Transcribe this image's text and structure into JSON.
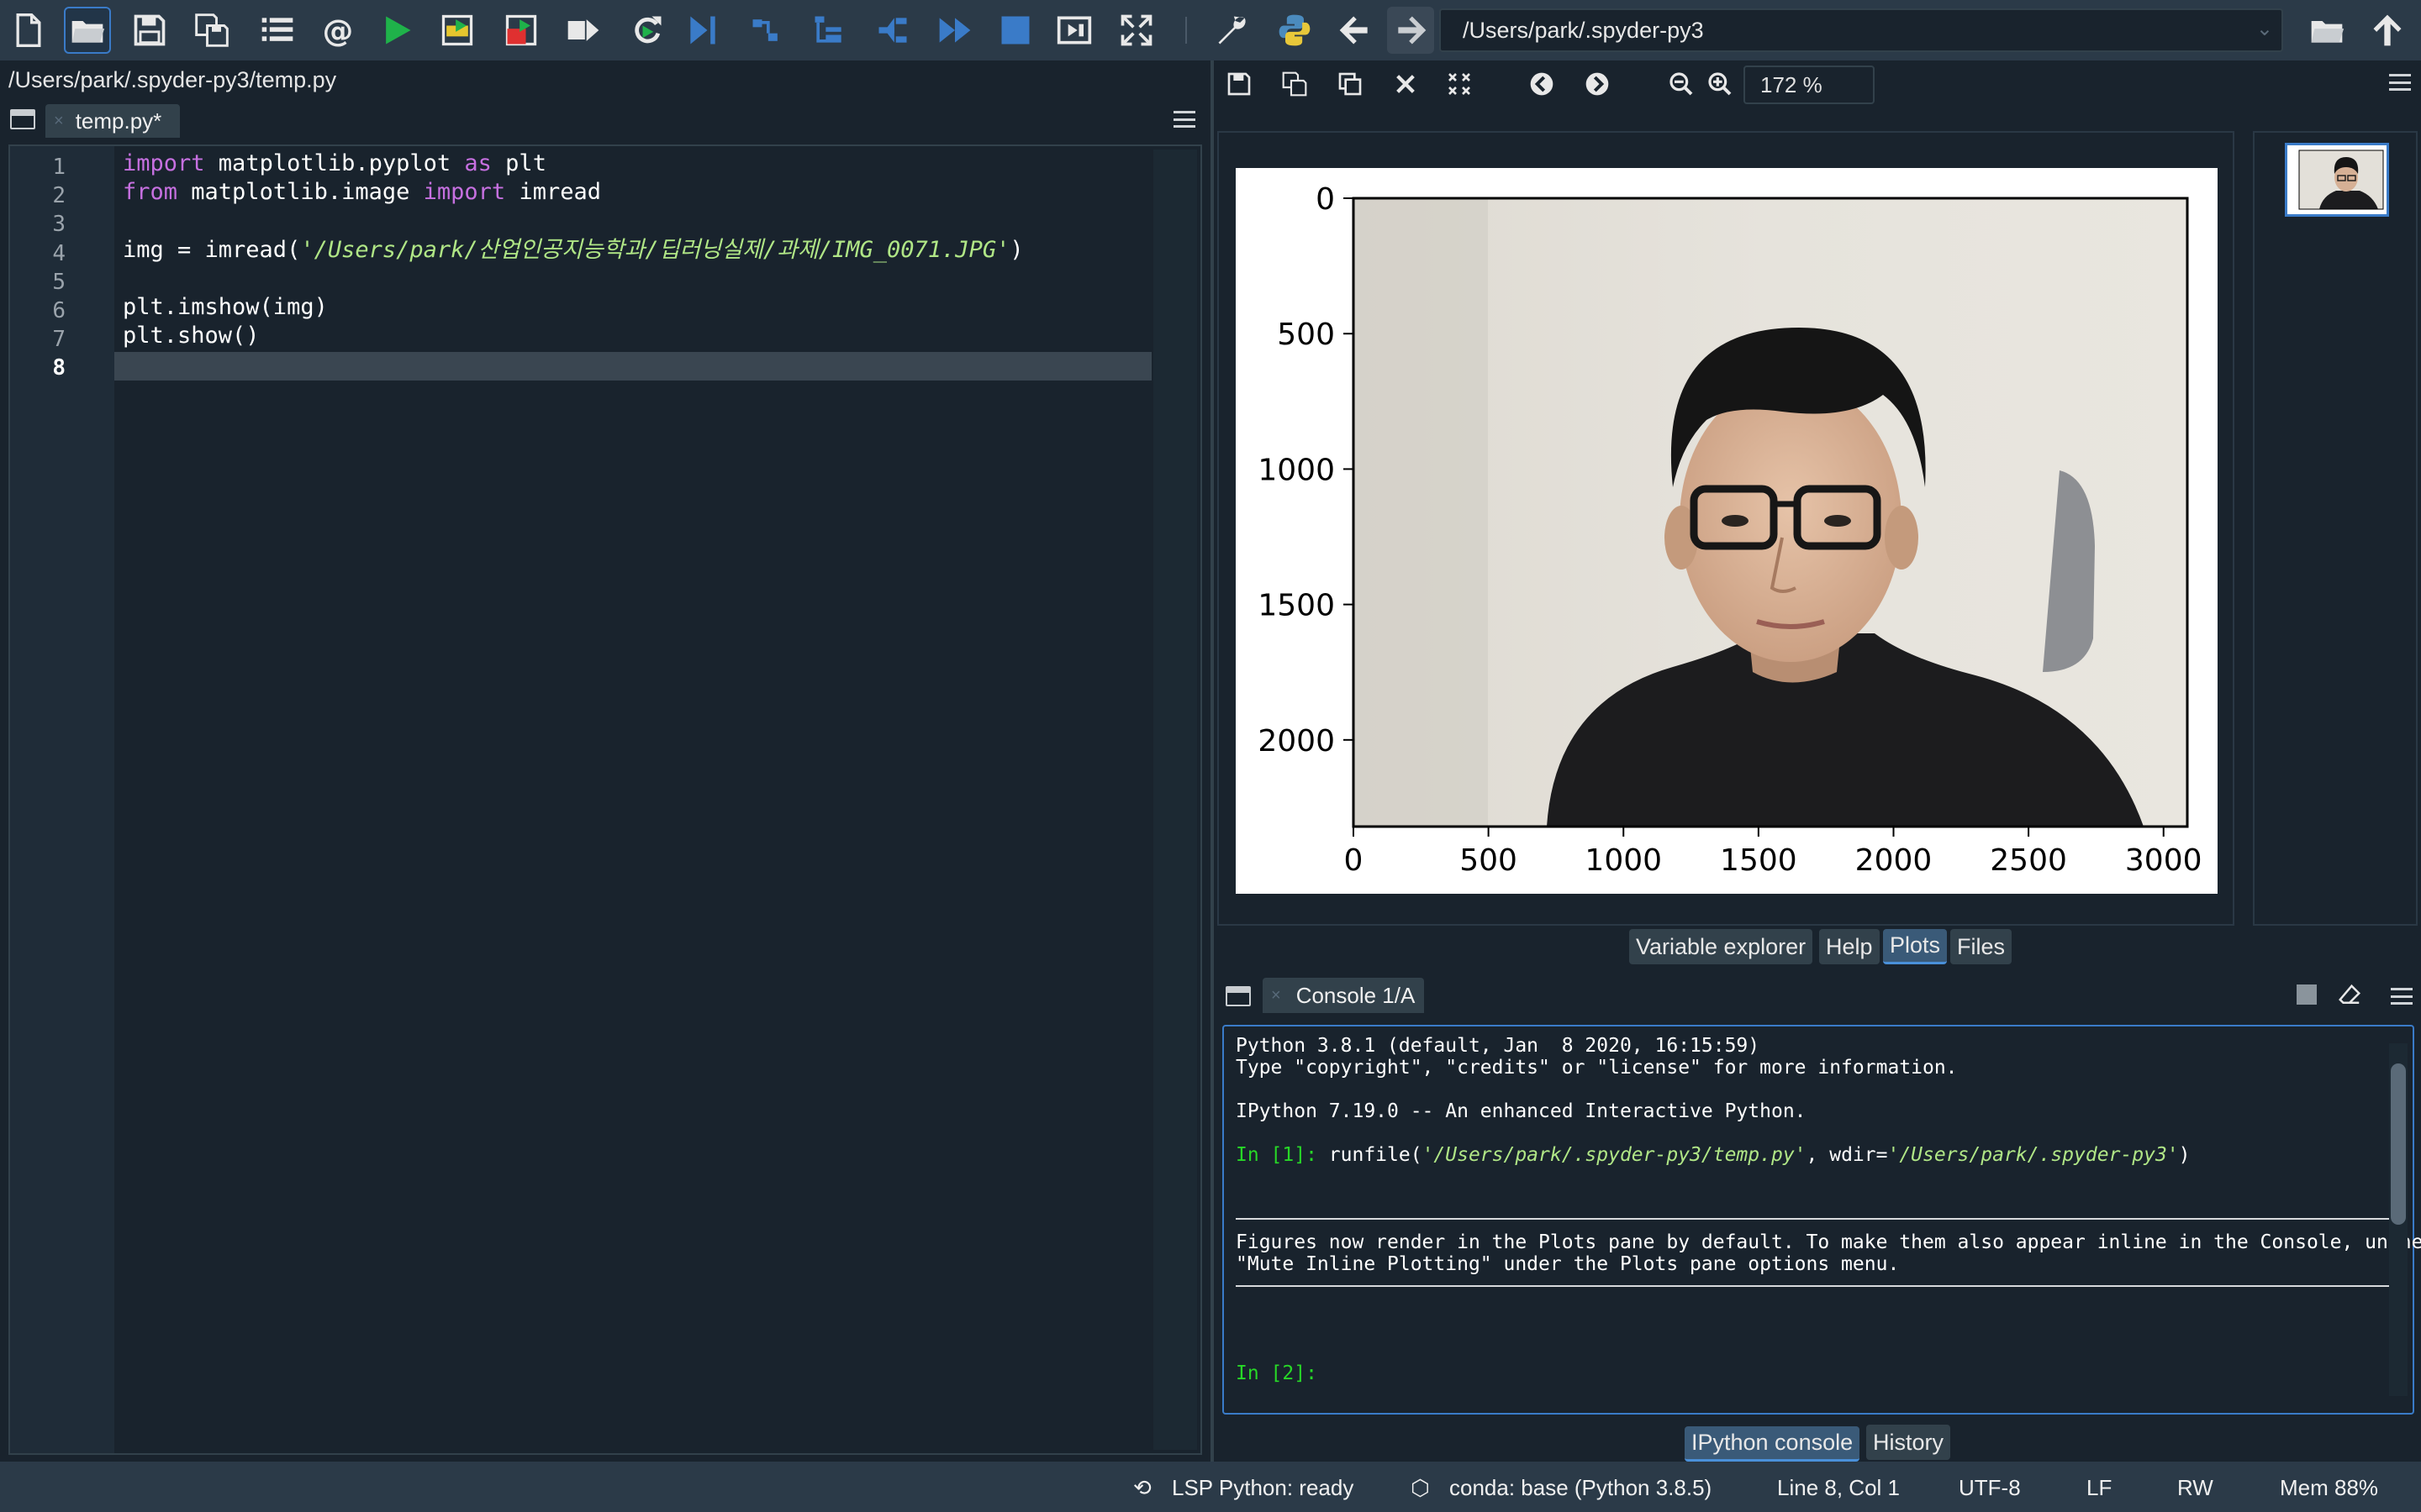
{
  "toolbar": {
    "icons": [
      "new-file-icon",
      "open-file-icon",
      "save-icon",
      "save-all-icon",
      "outline-icon",
      "at-icon",
      "run-icon",
      "run-cell-icon",
      "run-cell-advance-icon",
      "run-selection-icon",
      "debug-icon",
      "step-icon",
      "step-into-icon",
      "step-return-icon",
      "continue-icon",
      "stop-debug-icon",
      "maximize-pane-icon",
      "fullscreen-icon",
      "preferences-icon",
      "python-path-icon",
      "back-icon",
      "forward-icon",
      "browse-folder-icon",
      "parent-dir-icon"
    ],
    "working_dir": "/Users/park/.spyder-py3"
  },
  "editor": {
    "file_path": "/Users/park/.spyder-py3/temp.py",
    "tab_label": "temp.py*",
    "tab_close": "×",
    "current_line": 8,
    "line_numbers": [
      "1",
      "2",
      "3",
      "4",
      "5",
      "6",
      "7",
      "8"
    ],
    "lines": [
      [
        {
          "t": "import",
          "c": "kw"
        },
        {
          "t": " matplotlib.pyplot ",
          "c": ""
        },
        {
          "t": "as",
          "c": "kw"
        },
        {
          "t": " plt",
          "c": ""
        }
      ],
      [
        {
          "t": "from",
          "c": "kw"
        },
        {
          "t": " matplotlib.image ",
          "c": ""
        },
        {
          "t": "import",
          "c": "kw"
        },
        {
          "t": " imread",
          "c": ""
        }
      ],
      [],
      [
        {
          "t": "img = imread(",
          "c": ""
        },
        {
          "t": "'/Users/park/산업인공지능학과/딥러닝실제/과제/IMG_0071.JPG'",
          "c": "str"
        },
        {
          "t": ")",
          "c": ""
        }
      ],
      [],
      [
        {
          "t": "plt.imshow(img)",
          "c": ""
        }
      ],
      [
        {
          "t": "plt.show()",
          "c": ""
        }
      ],
      []
    ]
  },
  "plots": {
    "zoom": "172 %",
    "x_ticks": [
      "0",
      "500",
      "1000",
      "1500",
      "2000",
      "2500",
      "3000"
    ],
    "y_ticks": [
      "0",
      "500",
      "1000",
      "1500",
      "2000"
    ]
  },
  "chart_data": {
    "type": "image",
    "x_ticks": [
      0,
      500,
      1000,
      1500,
      2000,
      2500,
      3000
    ],
    "y_ticks": [
      0,
      500,
      1000,
      1500,
      2000
    ],
    "xlim": [
      0,
      3088
    ],
    "ylim": [
      2320,
      0
    ]
  },
  "plots_tabs": [
    "Variable explorer",
    "Help",
    "Plots",
    "Files"
  ],
  "plots_tab_selected": "Plots",
  "console": {
    "tab_label": "Console 1/A",
    "tab_close": "×",
    "line1": "Python 3.8.1 (default, Jan  8 2020, 16:15:59)",
    "line2": "Type \"copyright\", \"credits\" or \"license\" for more information.",
    "line3": "IPython 7.19.0 -- An enhanced Interactive Python.",
    "in1_prompt": "In [1]:",
    "in1_pre": " runfile(",
    "in1_file": "'/Users/park/.spyder-py3/temp.py'",
    "in1_mid": ", wdir=",
    "in1_wdir": "'/Users/park/.spyder-py3'",
    "in1_post": ")",
    "msg1": "Figures now render in the Plots pane by default. To make them also appear inline in the Console, unchecl",
    "msg2": "\"Mute Inline Plotting\" under the Plots pane options menu.",
    "in2_prompt": "In [2]:"
  },
  "console_tabs": [
    "IPython console",
    "History"
  ],
  "console_tab_selected": "IPython console",
  "statusbar": {
    "lsp": "LSP Python: ready",
    "conda": "conda: base (Python 3.8.5)",
    "position": "Line 8, Col 1",
    "encoding": "UTF-8",
    "eol": "LF",
    "rw": "RW",
    "mem": "Mem 88%"
  },
  "colors": {
    "background": "#19232d",
    "toolbar": "#2b3a48",
    "keyword": "#c670e0",
    "string": "#b0e686",
    "prompt": "#27d827",
    "accent": "#3a7bc8"
  }
}
